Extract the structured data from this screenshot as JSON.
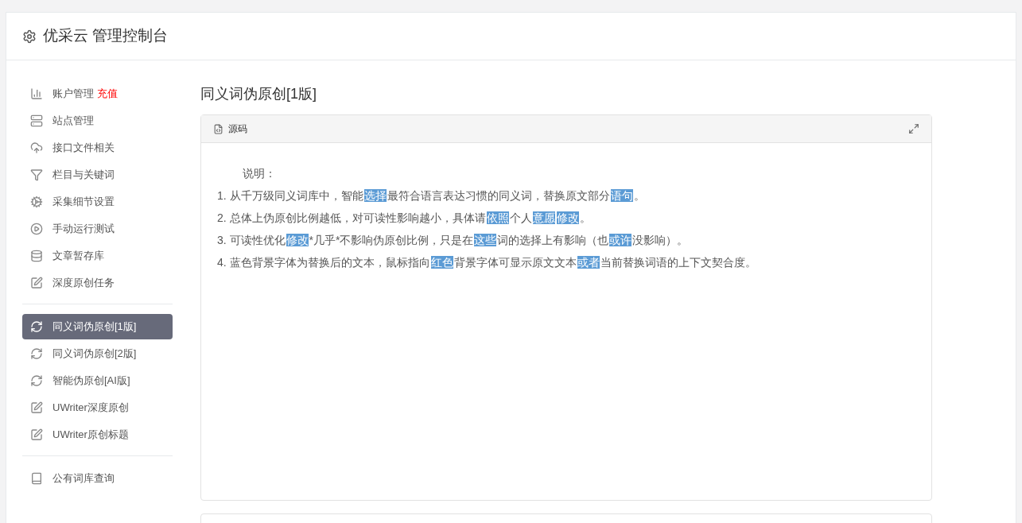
{
  "header": {
    "title": "优采云 管理控制台"
  },
  "sidebar": {
    "groups": [
      {
        "items": [
          {
            "label": "账户管理",
            "badge": "充值",
            "kind": "chart",
            "selected": false
          },
          {
            "label": "站点管理",
            "kind": "server",
            "selected": false
          },
          {
            "label": "接口文件相关",
            "kind": "cloud",
            "selected": false
          },
          {
            "label": "栏目与关键词",
            "kind": "filter",
            "selected": false
          },
          {
            "label": "采集细节设置",
            "kind": "gears",
            "selected": false
          },
          {
            "label": "手动运行测试",
            "kind": "play",
            "selected": false
          },
          {
            "label": "文章暂存库",
            "kind": "database",
            "selected": false
          },
          {
            "label": "深度原创任务",
            "kind": "edit",
            "selected": false
          }
        ]
      },
      {
        "items": [
          {
            "label": "同义词伪原创[1版]",
            "kind": "refresh",
            "selected": true
          },
          {
            "label": "同义词伪原创[2版]",
            "kind": "refresh",
            "selected": false
          },
          {
            "label": "智能伪原创[AI版]",
            "kind": "refresh",
            "selected": false
          },
          {
            "label": "UWriter深度原创",
            "kind": "edit",
            "selected": false
          },
          {
            "label": "UWriter原创标题",
            "kind": "edit",
            "selected": false
          }
        ]
      },
      {
        "items": [
          {
            "label": "公有词库查询",
            "kind": "book",
            "selected": false
          }
        ]
      }
    ]
  },
  "main": {
    "title": "同义词伪原创[1版]",
    "panel": {
      "tab": "源码",
      "heading": "说明：",
      "lines": [
        [
          {
            "text": "1. 从千万级同义词库中，智能",
            "highlighted": false
          },
          {
            "text": "选择",
            "highlighted": true
          },
          {
            "text": "最符合语言表达习惯的同义词，替换原文部分",
            "highlighted": false
          },
          {
            "text": "语句",
            "highlighted": true
          },
          {
            "text": "。",
            "highlighted": false
          }
        ],
        [
          {
            "text": "2. 总体上伪原创比例越低，对可读性影响越小，具体请",
            "highlighted": false
          },
          {
            "text": "依照",
            "highlighted": true
          },
          {
            "text": "个人",
            "highlighted": false
          },
          {
            "text": "意愿",
            "highlighted": true
          },
          {
            "text": "修改",
            "highlighted": true
          },
          {
            "text": "。",
            "highlighted": false
          }
        ],
        [
          {
            "text": "3. 可读性优化",
            "highlighted": false
          },
          {
            "text": "修改",
            "highlighted": true
          },
          {
            "text": "*几乎*不影响伪原创比例，只是在",
            "highlighted": false
          },
          {
            "text": "这些",
            "highlighted": true
          },
          {
            "text": "词的选择上有影响（也",
            "highlighted": false
          },
          {
            "text": "或许",
            "highlighted": true
          },
          {
            "text": "没影响）。",
            "highlighted": false
          }
        ],
        [
          {
            "text": "4. 蓝色背景字体为替换后的文本，鼠标指向",
            "highlighted": false
          },
          {
            "text": "红色",
            "highlighted": true
          },
          {
            "text": "背景字体可显示原文文本",
            "highlighted": false
          },
          {
            "text": "或者",
            "highlighted": true
          },
          {
            "text": "当前替换词语的上下文契合度。",
            "highlighted": false
          }
        ]
      ]
    }
  }
}
